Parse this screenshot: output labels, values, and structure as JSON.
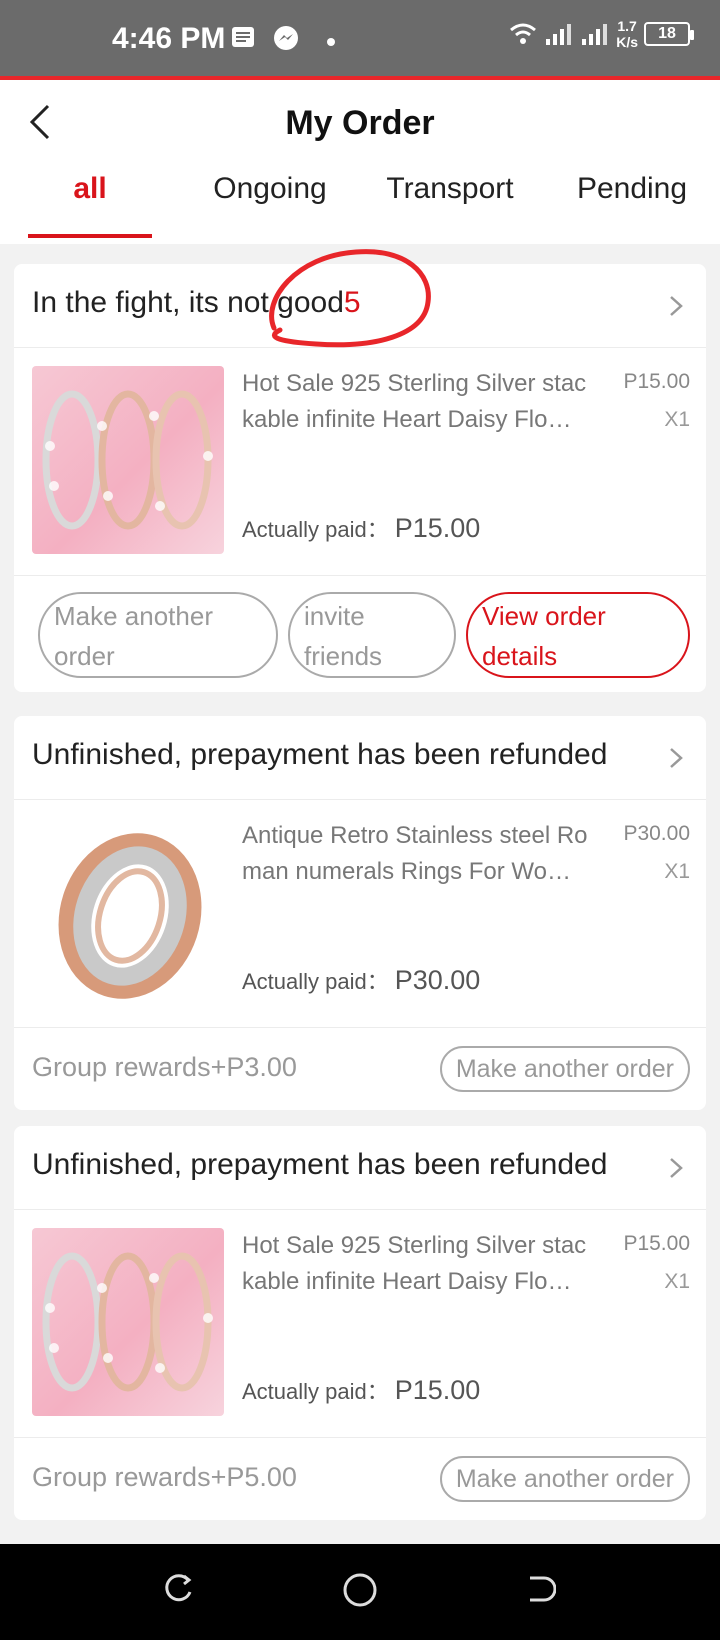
{
  "status_bar": {
    "time": "4:46 PM",
    "net_speed_value": "1.7",
    "net_speed_unit": "K/s",
    "battery": "18"
  },
  "header": {
    "title": "My Order",
    "tabs": [
      {
        "label": "all",
        "active": true
      },
      {
        "label": "Ongoing",
        "active": false
      },
      {
        "label": "Transport",
        "active": false
      },
      {
        "label": "Pending",
        "active": false
      }
    ]
  },
  "orders": [
    {
      "status": "In the fight, its not good",
      "status_count": "5",
      "product_name": "Hot Sale 925 Sterling Silver stackable infinite Heart Daisy Flo…",
      "price": "P15.00",
      "qty": "X1",
      "paid_label": "Actually paid：",
      "paid_amount": "P15.00",
      "buttons": [
        "Make another order",
        "invite friends",
        "View order details"
      ]
    },
    {
      "status": "Unfinished, prepayment has been refunded",
      "product_name": "Antique Retro Stainless steel Roman numerals Rings For Wo…",
      "price": "P30.00",
      "qty": "X1",
      "paid_label": "Actually paid：",
      "paid_amount": "P30.00",
      "reward": "Group rewards+P3.00",
      "button": "Make another order"
    },
    {
      "status": "Unfinished, prepayment has been refunded",
      "product_name": "Hot Sale 925 Sterling Silver stackable infinite Heart Daisy Flo…",
      "price": "P15.00",
      "qty": "X1",
      "paid_label": "Actually paid：",
      "paid_amount": "P15.00",
      "reward": "Group rewards+P5.00",
      "button": "Make another order"
    }
  ],
  "colors": {
    "accent": "#d9141b",
    "status_bar": "#6b6b6b",
    "background": "#f2f2f2"
  }
}
